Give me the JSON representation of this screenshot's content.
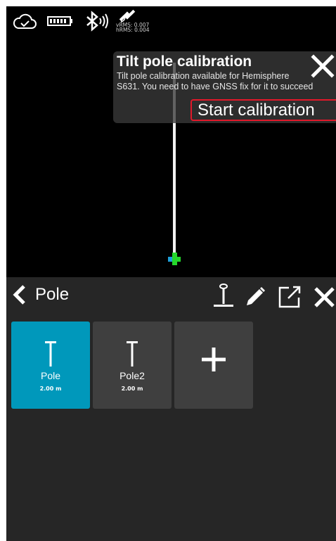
{
  "status": {
    "icons": [
      "cloud-check-icon",
      "battery-icon",
      "bluetooth-icon",
      "satellite-icon"
    ],
    "vrms": "vRMS: 0.007",
    "hrms": "hRMS: 0.004"
  },
  "toast": {
    "title": "Tilt pole calibration",
    "message": "Tilt pole calibration available for Hemisphere\nS631. You need to have GNSS fix for it to succeed",
    "start_button": "Start calibration",
    "close_icon": "close-icon",
    "accent_color": "#e3182a"
  },
  "panel": {
    "title": "Pole",
    "header_icons": [
      "back-chevron-icon",
      "pole-icon",
      "pencil-icon",
      "open-external-icon",
      "close-icon"
    ],
    "tiles": [
      {
        "name": "Pole",
        "height": "2.00 m",
        "selected": true
      },
      {
        "name": "Pole2",
        "height": "2.00 m",
        "selected": false
      }
    ],
    "add_tile_icon": "plus-icon",
    "selected_color": "#0098bb"
  }
}
